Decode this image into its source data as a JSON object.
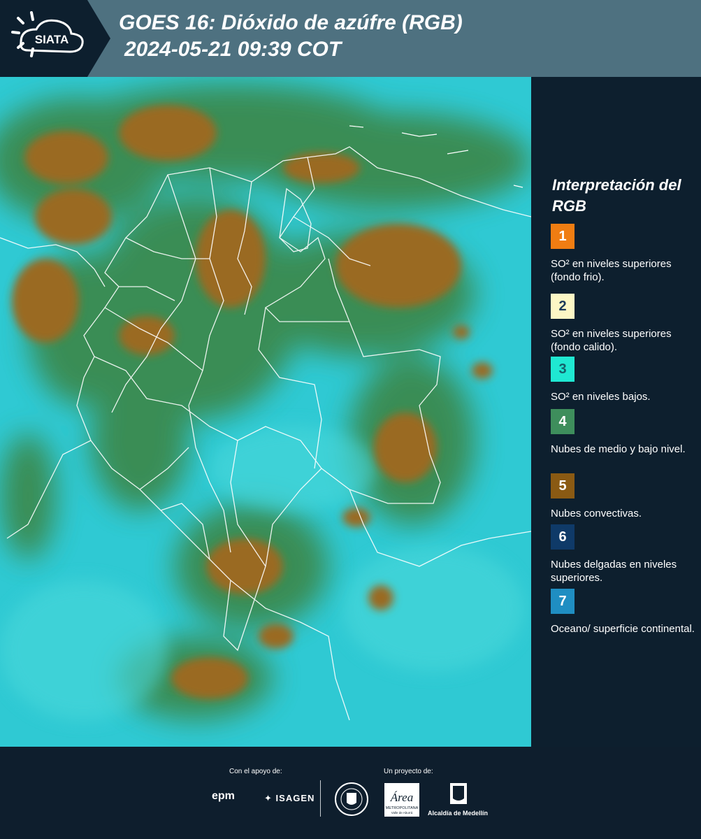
{
  "header": {
    "logo_text": "SIATA",
    "title_line1": "GOES 16: Dióxido de azúfre (RGB)",
    "title_line2": "2024-05-21 09:39 COT"
  },
  "legend": {
    "title": "Interpretación del RGB",
    "items": [
      {
        "number": "1",
        "color": "#f07d12",
        "label": "SO² en niveles superiores (fondo frio)."
      },
      {
        "number": "2",
        "color": "#fdf7c5",
        "label": "SO² en niveles superiores (fondo calido)."
      },
      {
        "number": "3",
        "color": "#1fe8d2",
        "label": "SO² en niveles bajos."
      },
      {
        "number": "4",
        "color": "#3e8e5c",
        "label": "Nubes de medio y bajo nivel."
      },
      {
        "number": "5",
        "color": "#8a5a13",
        "label": "Nubes convectivas."
      },
      {
        "number": "6",
        "color": "#0f3a68",
        "label": "Nubes delgadas en niveles superiores."
      },
      {
        "number": "7",
        "color": "#1f8ec2",
        "label": "Oceano/ superficie continental."
      }
    ]
  },
  "footer": {
    "support_label": "Con el apoyo de:",
    "project_label": "Un proyecto de:",
    "epm_text": "epm",
    "isagen_text": "ISAGEN",
    "area_text": "Área",
    "area_sub": "METROPOLITANA",
    "area_sub2": "Valle de Aburrá",
    "alcaldia_text": "Alcaldía de Medellín"
  },
  "map": {
    "sea_color": "#2fc9d3",
    "cloud_color": "#9a6a22",
    "vegetation_color": "#3b8a4f",
    "border_color": "#ffffff"
  }
}
